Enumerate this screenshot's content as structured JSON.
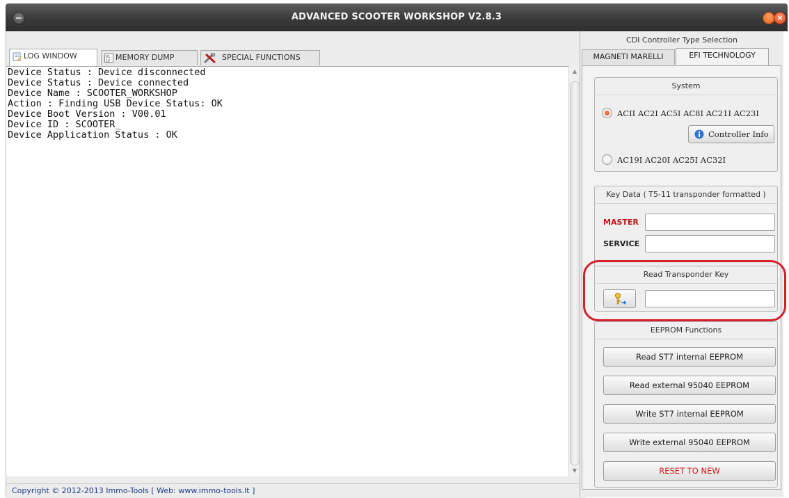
{
  "window": {
    "title": "ADVANCED SCOOTER WORKSHOP  V2.8.3",
    "close_glyph": "×"
  },
  "tabs": [
    {
      "label": "LOG WINDOW",
      "icon": "log-icon",
      "active": true
    },
    {
      "label": "MEMORY DUMP",
      "icon": "binary-icon",
      "active": false
    },
    {
      "label": "SPECIAL FUNCTIONS",
      "icon": "tools-icon",
      "active": false
    }
  ],
  "log_lines": [
    "Device Status : Device disconnected",
    "Device Status : Device connected",
    "Device Name : SCOOTER_WORKSHOP",
    "Action : Finding USB Device Status: OK",
    "Device Boot Version : V00.01",
    "Device ID : SCOOTER_",
    "Device Application Status : OK"
  ],
  "status_bar": "Copyright © 2012-2013 Immo-Tools [ Web: www.immo-tools.lt ]",
  "cdi": {
    "title": "CDI Controller Type Selection",
    "tabs": [
      {
        "label": "MAGNETI MARELLI",
        "active": false
      },
      {
        "label": "EFI TECHNOLOGY",
        "active": true
      }
    ]
  },
  "system": {
    "title": "System",
    "option1": "ACII AC2I AC5I AC8I AC21I AC23I",
    "option1_selected": true,
    "controller_info_label": "Controller Info",
    "option2": "AC19I AC20I AC25I AC32I",
    "option2_selected": false
  },
  "key_data": {
    "title": "Key Data ( T5-11 transponder formatted )",
    "master_label": "MASTER",
    "master_value": "",
    "service_label": "SERVICE",
    "service_value": ""
  },
  "read_transponder": {
    "title": "Read Transponder Key",
    "value": ""
  },
  "eeprom": {
    "title": "EEPROM Functions",
    "read_st7": "Read ST7 internal EEPROM",
    "read_ext": "Read external 95040 EEPROM",
    "write_st7": "Write ST7 internal EEPROM",
    "write_ext": "Write external 95040 EEPROM",
    "reset": "RESET TO NEW"
  },
  "colors": {
    "highlight": "#d3202a",
    "master_label": "#c0141c",
    "reset_text": "#d01818",
    "radio_selected": "#e0561f"
  }
}
